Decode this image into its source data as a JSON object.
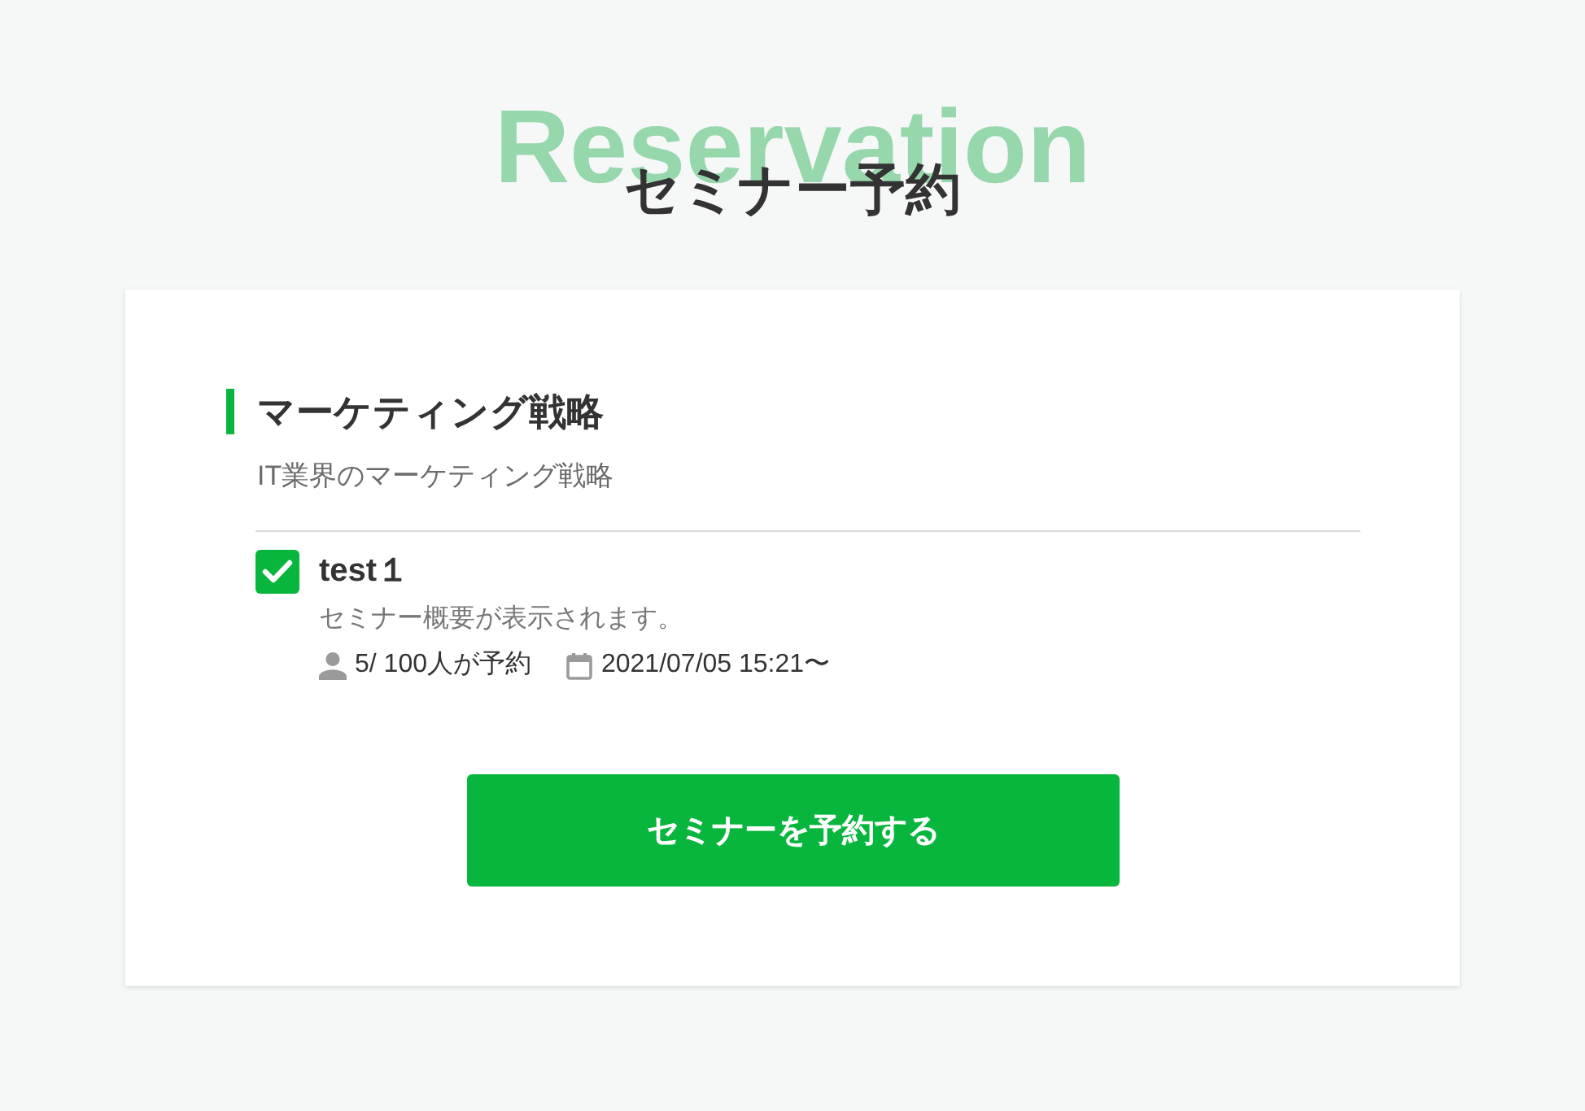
{
  "background_title": "Reservation",
  "title": "セミナー予約",
  "category": {
    "name": "マーケティング戦略",
    "description": "IT業界のマーケティング戦略"
  },
  "seminars": [
    {
      "name": "test１",
      "checked": true,
      "summary": "セミナー概要が表示されます。",
      "reservations": "5/ 100人が予約",
      "datetime": "2021/07/05 15:21〜"
    }
  ],
  "submit_button": "セミナーを予約する"
}
